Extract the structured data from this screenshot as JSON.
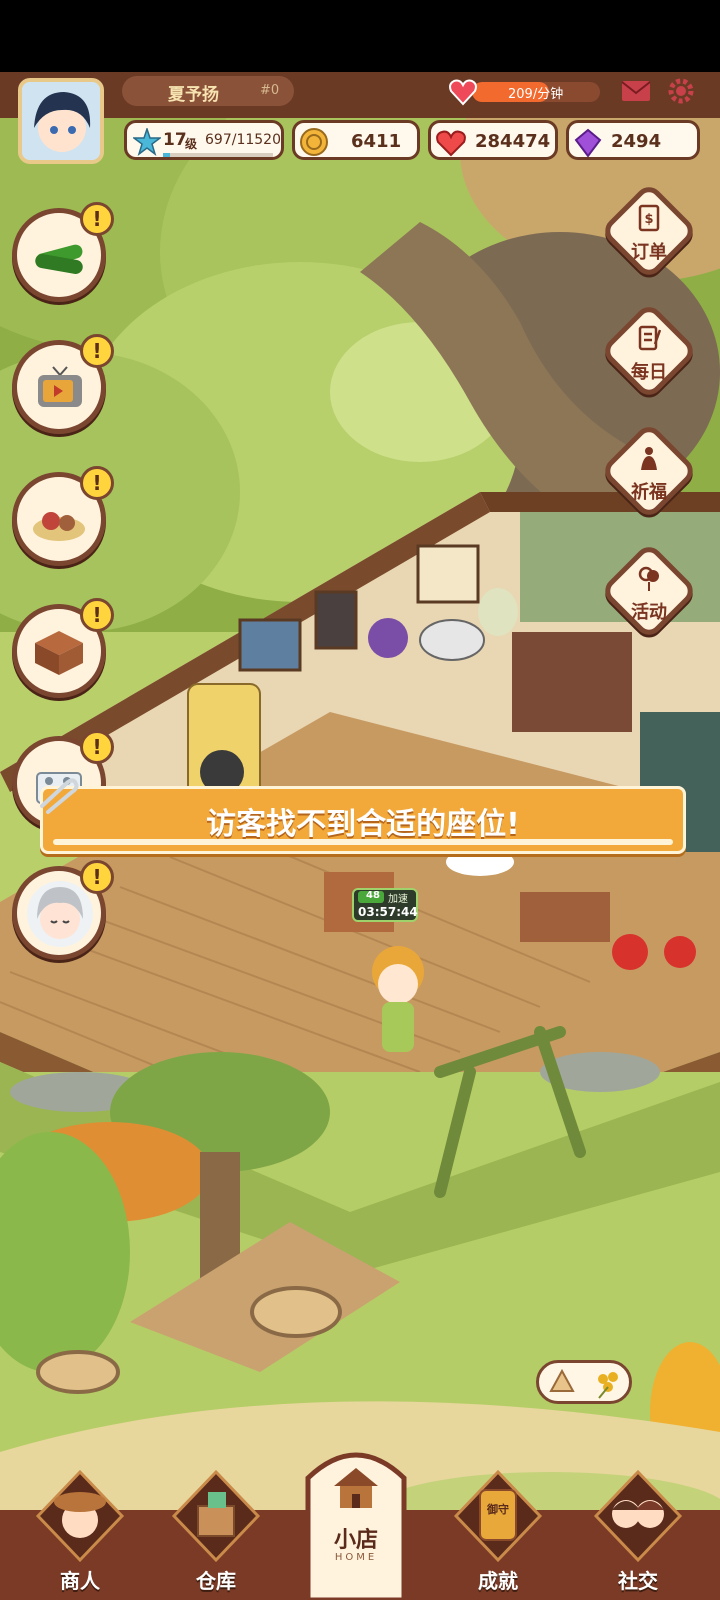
{
  "player": {
    "name": "夏予扬",
    "id_tag": "#0",
    "level": "17",
    "level_unit": "级",
    "exp": "697/11520",
    "exp_fraction": 0.06
  },
  "stamina": {
    "rate": "209/分钟",
    "fill_fraction": 0.6
  },
  "currencies": {
    "coins": "6411",
    "hearts": "284474",
    "gems": "2494"
  },
  "right_menu": [
    {
      "label": "订单",
      "icon": "order-book-icon"
    },
    {
      "label": "每日",
      "icon": "daily-checklist-icon"
    },
    {
      "label": "祈福",
      "icon": "prayer-icon"
    },
    {
      "label": "活动",
      "icon": "balloon-activity-icon"
    }
  ],
  "left_menu": [
    {
      "icon": "cucumber-icon",
      "alert": "!"
    },
    {
      "icon": "tv-video-icon",
      "alert": "!"
    },
    {
      "icon": "dish-icon",
      "alert": "!"
    },
    {
      "icon": "desk-furniture-icon",
      "alert": "!"
    },
    {
      "icon": "stove-icon",
      "alert": "!"
    },
    {
      "icon": "grandma-avatar-icon",
      "alert": "!"
    }
  ],
  "banner": {
    "message": "访客找不到合适的座位!"
  },
  "timer": {
    "badge": "48",
    "boost_label": "加速",
    "time": "03:57:44"
  },
  "bottom_nav": [
    {
      "label": "商人"
    },
    {
      "label": "仓库"
    },
    {
      "label": "小店",
      "sub": "HOME"
    },
    {
      "label": "成就",
      "sign": "御守"
    },
    {
      "label": "社交"
    }
  ],
  "colors": {
    "frame_brown": "#6b3a24",
    "banner_orange": "#f2a93a",
    "pill_bg": "#fff8ec",
    "stamina_bar": "#f26a2e",
    "grass": "#a8c95a"
  }
}
